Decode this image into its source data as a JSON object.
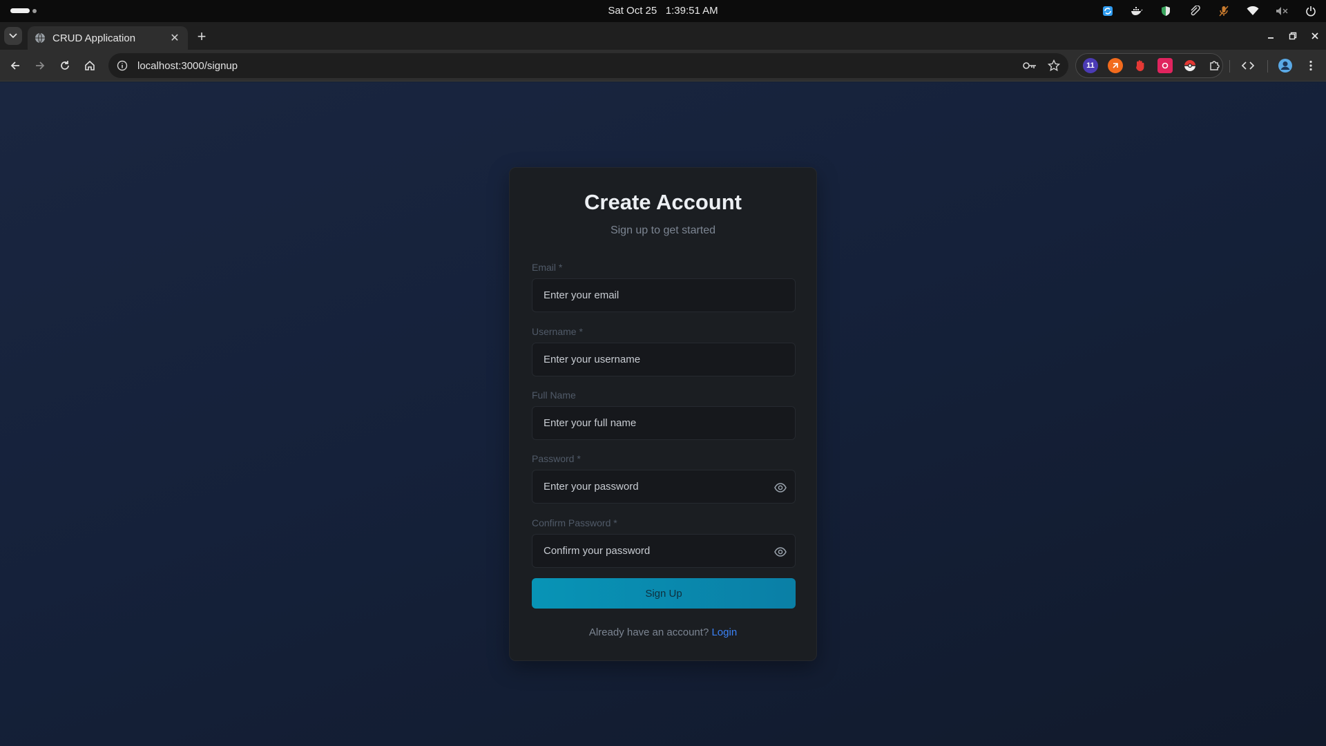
{
  "system": {
    "clock_date": "Sat Oct 25",
    "clock_time": "1:39:51 AM",
    "tray_icons": [
      "app-indicator-icon",
      "docker-icon",
      "shield-icon",
      "paperclip-icon",
      "mic-muted-icon",
      "wifi-icon",
      "volume-muted-icon",
      "power-icon"
    ]
  },
  "browser": {
    "tab_title": "CRUD Application",
    "url": "localhost:3000/signup",
    "extension_badge": "11"
  },
  "form": {
    "title": "Create Account",
    "subtitle": "Sign up to get started",
    "email_label": "Email *",
    "email_placeholder": "Enter your email",
    "username_label": "Username *",
    "username_placeholder": "Enter your username",
    "fullname_label": "Full Name",
    "fullname_placeholder": "Enter your full name",
    "password_label": "Password *",
    "password_placeholder": "Enter your password",
    "confirm_label": "Confirm Password *",
    "confirm_placeholder": "Confirm your password",
    "submit_label": "Sign Up",
    "footer_text": "Already have an account?",
    "login_link": "Login"
  },
  "colors": {
    "accent": "#0894b6",
    "link": "#3b82f6",
    "background": "#15213a",
    "card": "#1b1e22"
  }
}
